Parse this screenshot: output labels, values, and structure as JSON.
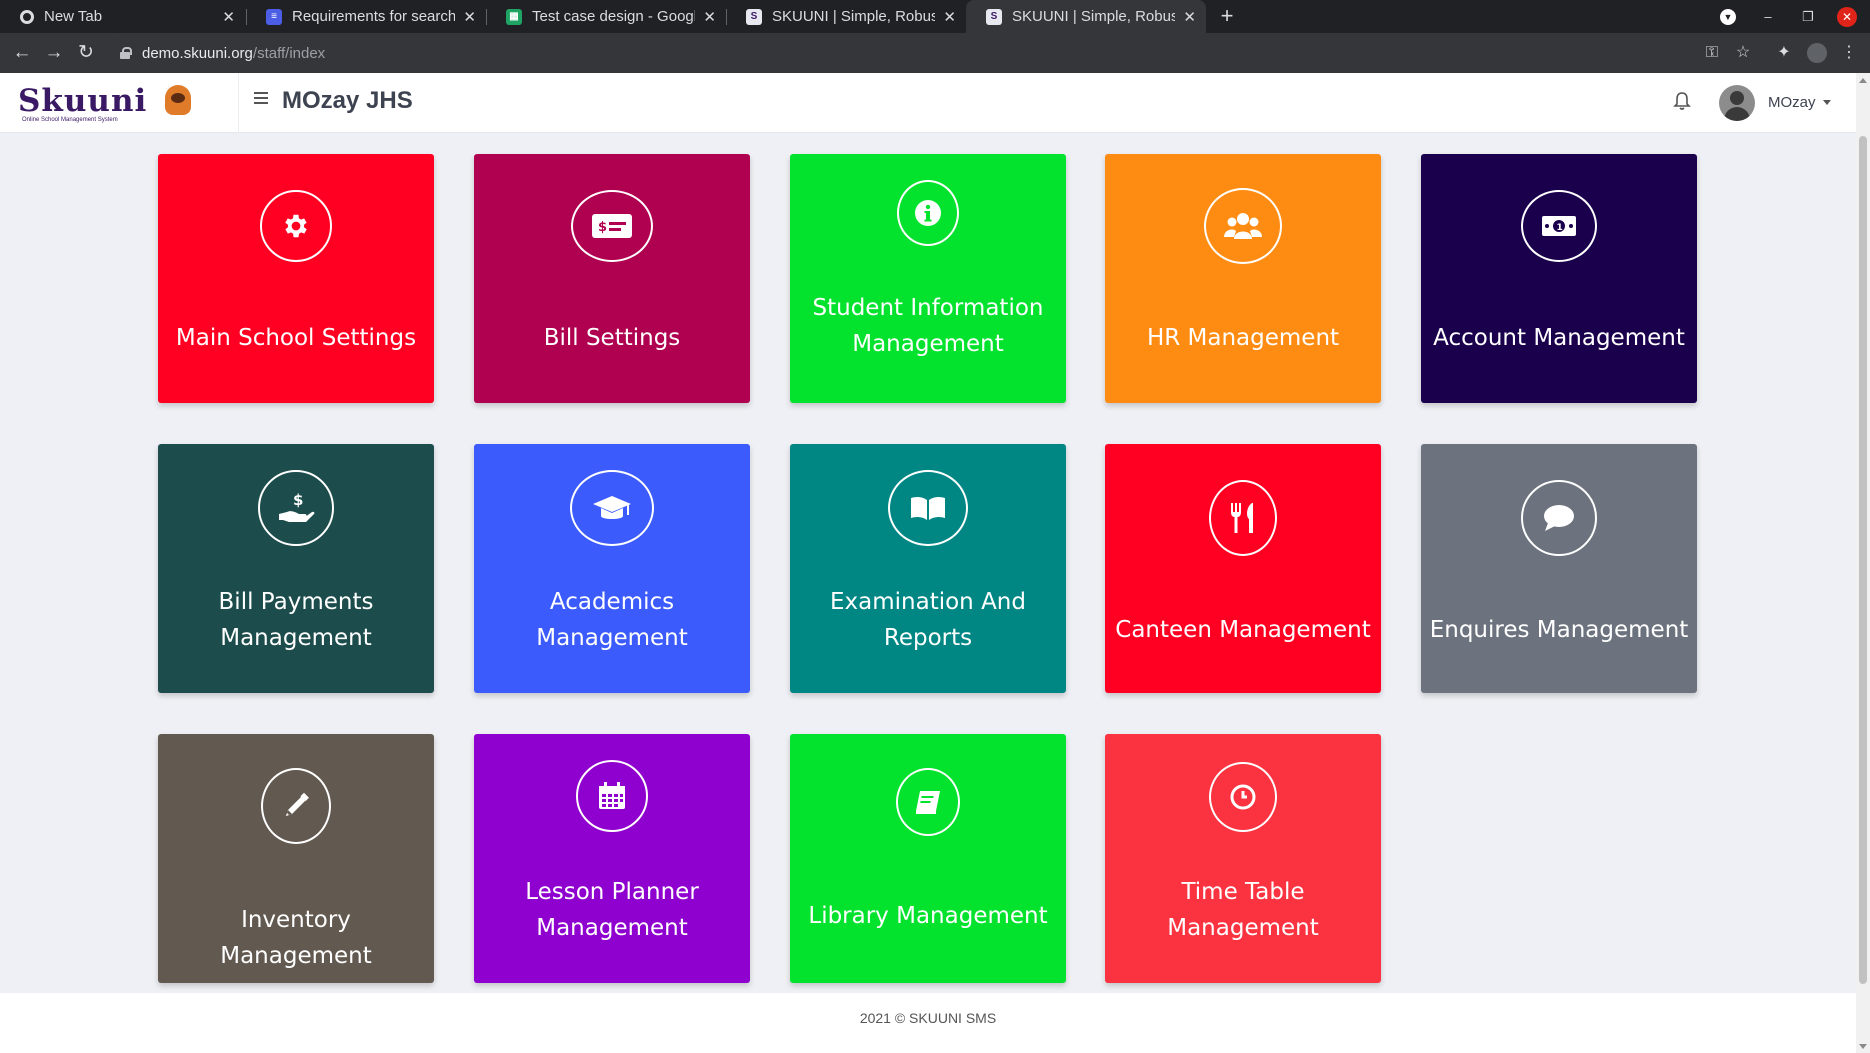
{
  "browser": {
    "tabs": [
      {
        "label": "New Tab",
        "icon": "chrome-icon",
        "color": "#202124"
      },
      {
        "label": "Requirements for searchi",
        "icon": "docs-icon",
        "color": "#4c5ee6"
      },
      {
        "label": "Test case design - Google",
        "icon": "sheets-icon",
        "color": "#1fa463"
      },
      {
        "label": "SKUUNI | Simple, Robust,",
        "icon": "skuuni-favicon",
        "color": "#3a1a64"
      },
      {
        "label": "SKUUNI | Simple, Robust,",
        "icon": "skuuni-favicon",
        "color": "#3a1a64"
      }
    ],
    "url_host": "demo.skuuni.org",
    "url_path": "/staff/index"
  },
  "header": {
    "logo_text": "Skuuni",
    "logo_tagline": "Online School Management System",
    "school_name": "MOzay JHS",
    "username": "MOzay"
  },
  "tiles": [
    {
      "label": "Main School Settings",
      "icon": "gear-icon",
      "color": "#ff0022"
    },
    {
      "label": "Bill Settings",
      "icon": "bill-icon",
      "color": "#b00050"
    },
    {
      "label": "Student Information Management",
      "icon": "info-icon",
      "color": "#03e22d"
    },
    {
      "label": "HR Management",
      "icon": "users-icon",
      "color": "#ff8c12"
    },
    {
      "label": "Account Management",
      "icon": "money-icon",
      "color": "#1a004c"
    },
    {
      "label": "Bill Payments Management",
      "icon": "hand-dollar-icon",
      "color": "#1c4d4c"
    },
    {
      "label": "Academics Management",
      "icon": "graduation-cap-icon",
      "color": "#3c5bfc"
    },
    {
      "label": "Examination And Reports",
      "icon": "book-open-icon",
      "color": "#008784"
    },
    {
      "label": "Canteen Management",
      "icon": "utensils-icon",
      "color": "#ff0022"
    },
    {
      "label": "Enquires Management",
      "icon": "comment-icon",
      "color": "#6c737e"
    },
    {
      "label": "Inventory Management",
      "icon": "pencil-icon",
      "color": "#625950"
    },
    {
      "label": "Lesson Planner Management",
      "icon": "calendar-icon",
      "color": "#8e01cf"
    },
    {
      "label": "Library Management",
      "icon": "book-icon",
      "color": "#03e22d"
    },
    {
      "label": "Time Table Management",
      "icon": "clock-icon",
      "color": "#fb3341"
    }
  ],
  "footer": {
    "text": "2021 © SKUUNI SMS"
  }
}
